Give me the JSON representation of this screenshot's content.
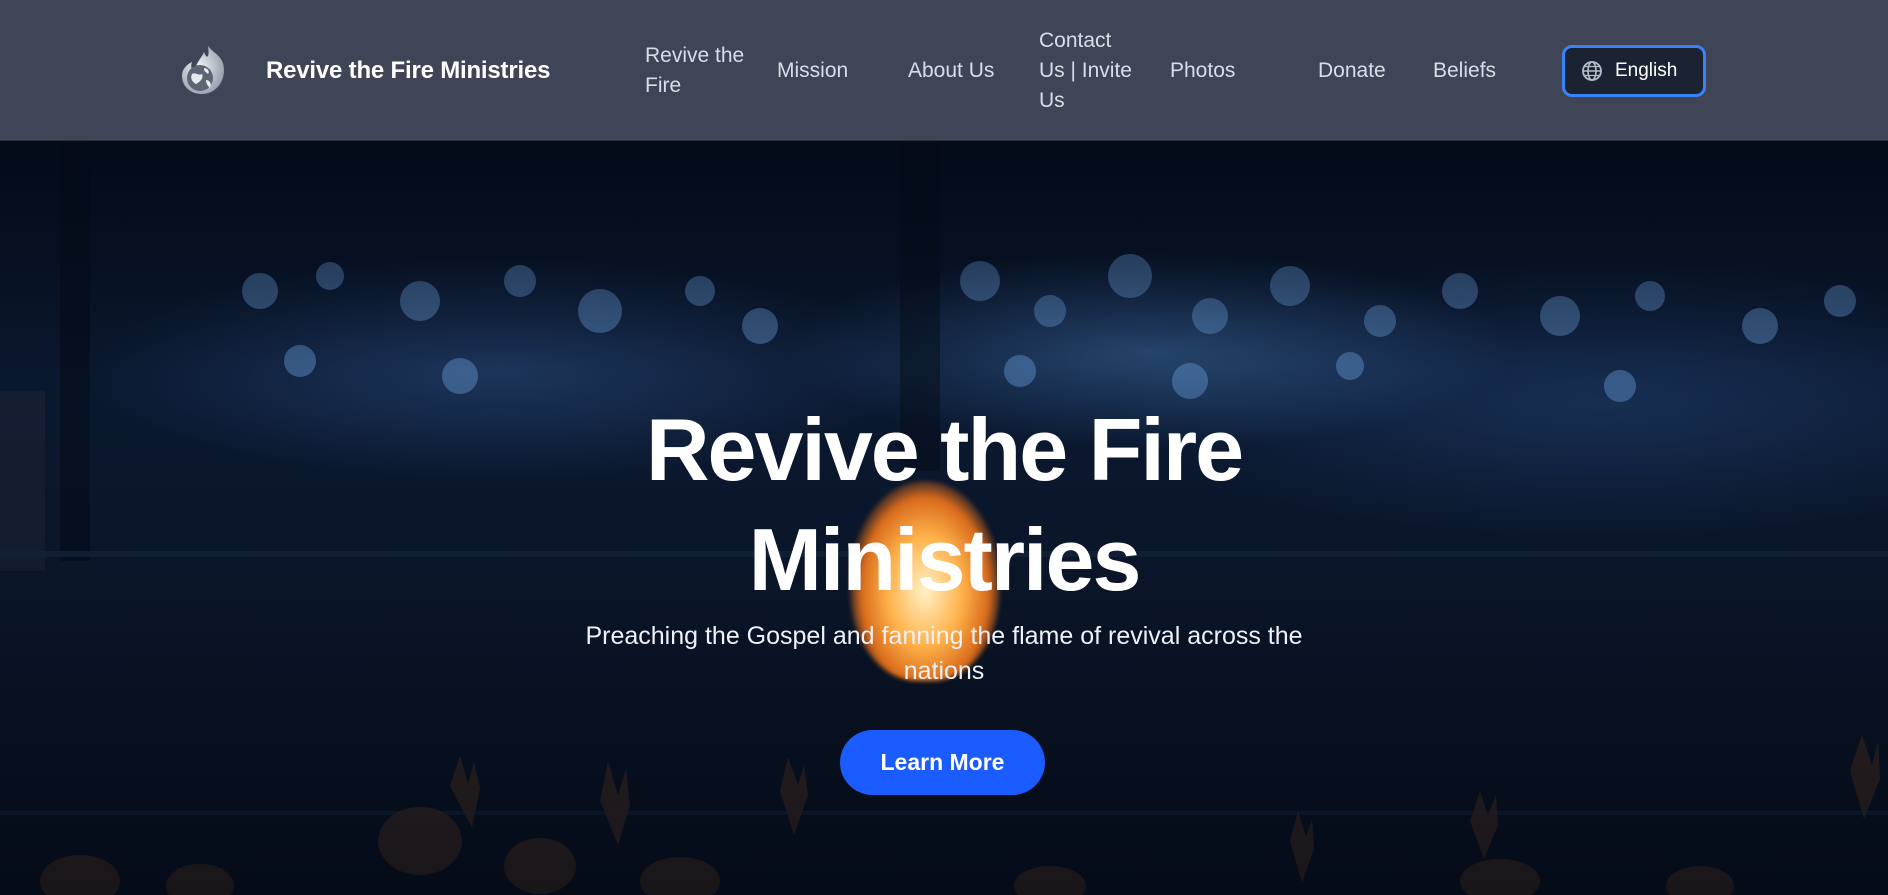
{
  "header": {
    "brand_name": "Revive the Fire Ministries",
    "logo_icon": "flame-globe-logo-icon",
    "nav": [
      {
        "label_lines": [
          "Revive the",
          "Fire"
        ]
      },
      {
        "label_lines": [
          "Mission"
        ]
      },
      {
        "label_lines": [
          "About Us"
        ]
      },
      {
        "label_lines": [
          "Contact",
          "Us | Invite",
          "Us"
        ]
      },
      {
        "label_lines": [
          "Photos"
        ]
      },
      {
        "label_lines": [
          "Donate"
        ]
      },
      {
        "label_lines": [
          "Beliefs"
        ]
      }
    ],
    "language": {
      "label": "English",
      "icon": "globe-icon"
    }
  },
  "hero": {
    "title_lines": [
      "Revive the Fire",
      "Ministries"
    ],
    "subtitle_lines": [
      "Preaching the Gospel and fanning the flame of revival across the",
      "nations"
    ],
    "cta_label": "Learn More",
    "background_image": "worship-crowd-raised-hands-photo"
  },
  "colors": {
    "header_bg": "#3f4556",
    "nav_text": "#d9dde6",
    "accent": "#1a5cff",
    "lang_border": "#3b82f6",
    "hero_bg": "#0b1a33"
  }
}
